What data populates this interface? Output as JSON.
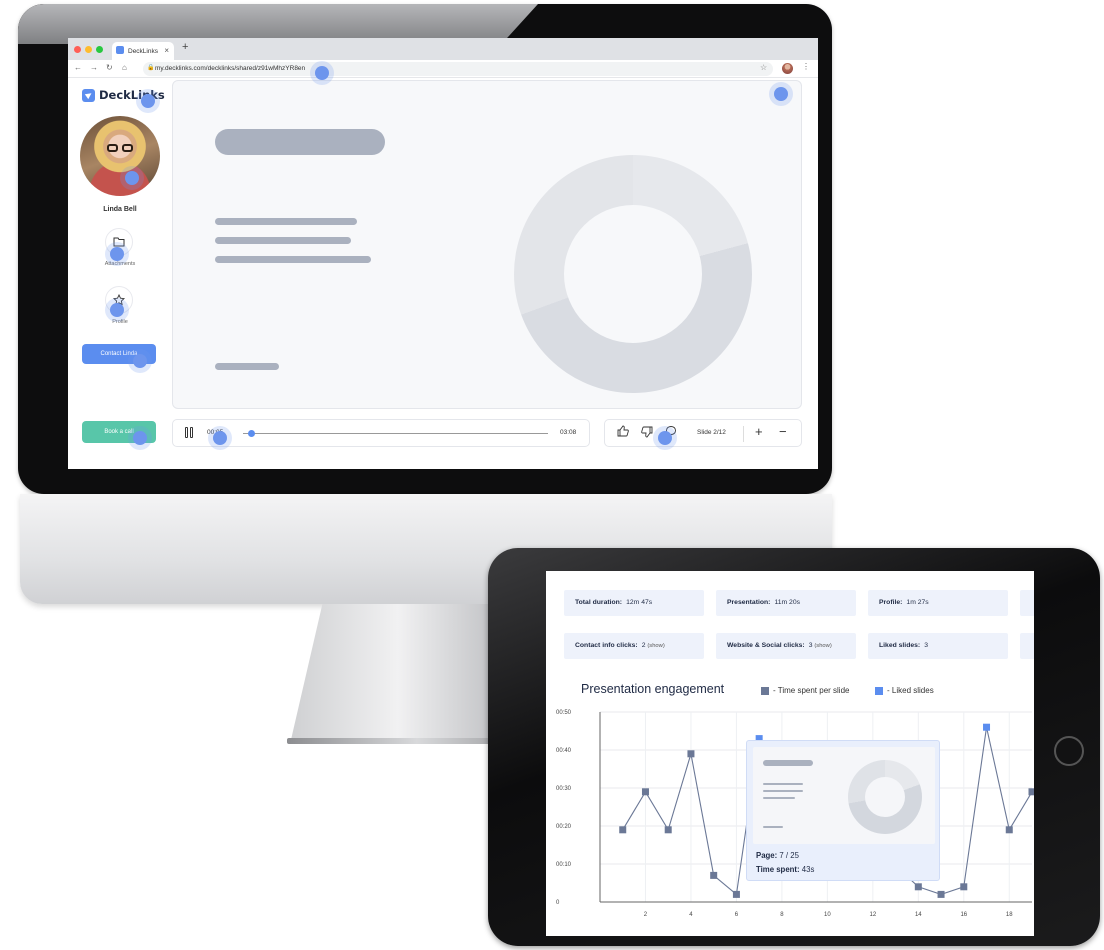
{
  "browser": {
    "tab_title": "DeckLinks",
    "tab_close": "×",
    "new_tab": "+",
    "url": "my.decklinks.com/decklinks/shared/z91wMhzYR8en"
  },
  "app": {
    "logo": "DeckLinks",
    "user_name": "Linda Bell",
    "attachments_label": "Attachments",
    "profile_label": "Profile",
    "contact_button": "Contact Linda",
    "book_button": "Book a call",
    "player": {
      "current_time": "00:05",
      "total_time": "03:08",
      "progress_fraction": 0.027
    },
    "slide_counter": "Slide 2/12",
    "zoom_in": "+",
    "zoom_out": "−"
  },
  "analytics": {
    "stats": [
      {
        "label": "Total duration:",
        "value": "12m 47s"
      },
      {
        "label": "Presentation:",
        "value": "11m 20s"
      },
      {
        "label": "Profile:",
        "value": "1m 27s"
      },
      {
        "label": "Contact info clicks:",
        "value": "2",
        "extra": "(show)"
      },
      {
        "label": "Website & Social clicks:",
        "value": "3",
        "extra": "(show)"
      },
      {
        "label": "Liked slides:",
        "value": "3"
      }
    ],
    "title": "Presentation engagement",
    "legend": [
      {
        "label": "- Time spent per slide",
        "color": "#6b7896"
      },
      {
        "label": "- Liked slides",
        "color": "#5b8def"
      }
    ],
    "tooltip": {
      "page_label": "Page:",
      "page_value": "7 / 25",
      "time_label": "Time spent:",
      "time_value": "43s"
    }
  },
  "chart_data": {
    "type": "line",
    "title": "Presentation engagement",
    "y_ticks": [
      "00:50",
      "00:40",
      "00:30",
      "00:20",
      "00:10",
      "0"
    ],
    "x_ticks": [
      "2",
      "4",
      "6",
      "8",
      "10",
      "12",
      "14",
      "16",
      "18"
    ],
    "ylim": [
      0,
      50
    ],
    "xlim": [
      0,
      19
    ],
    "series": [
      {
        "name": "Time spent per slide",
        "x": [
          1,
          2,
          3,
          4,
          5,
          6,
          7,
          14,
          15,
          16,
          17,
          18,
          19
        ],
        "y": [
          19,
          29,
          19,
          39,
          7,
          2,
          43,
          4,
          2,
          4,
          46,
          19,
          29
        ],
        "liked": [
          false,
          false,
          false,
          false,
          false,
          false,
          true,
          false,
          false,
          false,
          true,
          false,
          false
        ]
      }
    ],
    "grid": true
  }
}
